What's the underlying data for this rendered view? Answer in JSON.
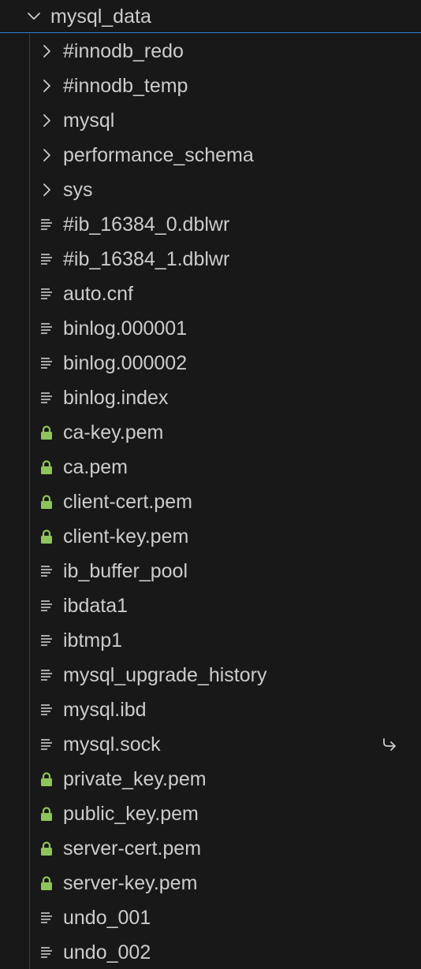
{
  "explorer": {
    "root": {
      "label": "mysql_data",
      "icon": "chevron-down-icon"
    },
    "items": [
      {
        "label": "#innodb_redo",
        "kind": "folder",
        "icon": "chevron-right-icon"
      },
      {
        "label": "#innodb_temp",
        "kind": "folder",
        "icon": "chevron-right-icon"
      },
      {
        "label": "mysql",
        "kind": "folder",
        "icon": "chevron-right-icon"
      },
      {
        "label": "performance_schema",
        "kind": "folder",
        "icon": "chevron-right-icon"
      },
      {
        "label": "sys",
        "kind": "folder",
        "icon": "chevron-right-icon"
      },
      {
        "label": "#ib_16384_0.dblwr",
        "kind": "file",
        "icon": "file-lines-icon"
      },
      {
        "label": "#ib_16384_1.dblwr",
        "kind": "file",
        "icon": "file-lines-icon"
      },
      {
        "label": "auto.cnf",
        "kind": "file",
        "icon": "file-lines-icon"
      },
      {
        "label": "binlog.000001",
        "kind": "file",
        "icon": "file-lines-icon"
      },
      {
        "label": "binlog.000002",
        "kind": "file",
        "icon": "file-lines-icon"
      },
      {
        "label": "binlog.index",
        "kind": "file",
        "icon": "file-lines-icon"
      },
      {
        "label": "ca-key.pem",
        "kind": "locked",
        "icon": "lock-icon"
      },
      {
        "label": "ca.pem",
        "kind": "locked",
        "icon": "lock-icon"
      },
      {
        "label": "client-cert.pem",
        "kind": "locked",
        "icon": "lock-icon"
      },
      {
        "label": "client-key.pem",
        "kind": "locked",
        "icon": "lock-icon"
      },
      {
        "label": "ib_buffer_pool",
        "kind": "file",
        "icon": "file-lines-icon"
      },
      {
        "label": "ibdata1",
        "kind": "file",
        "icon": "file-lines-icon"
      },
      {
        "label": "ibtmp1",
        "kind": "file",
        "icon": "file-lines-icon"
      },
      {
        "label": "mysql_upgrade_history",
        "kind": "file",
        "icon": "file-lines-icon"
      },
      {
        "label": "mysql.ibd",
        "kind": "file",
        "icon": "file-lines-icon"
      },
      {
        "label": "mysql.sock",
        "kind": "file",
        "icon": "file-lines-icon",
        "badge_icon": "symlink-arrow-icon"
      },
      {
        "label": "private_key.pem",
        "kind": "locked",
        "icon": "lock-icon"
      },
      {
        "label": "public_key.pem",
        "kind": "locked",
        "icon": "lock-icon"
      },
      {
        "label": "server-cert.pem",
        "kind": "locked",
        "icon": "lock-icon"
      },
      {
        "label": "server-key.pem",
        "kind": "locked",
        "icon": "lock-icon"
      },
      {
        "label": "undo_001",
        "kind": "file",
        "icon": "file-lines-icon"
      },
      {
        "label": "undo_002",
        "kind": "file",
        "icon": "file-lines-icon"
      }
    ]
  },
  "colors": {
    "background": "#181818",
    "text": "#cccccc",
    "lock": "#8fc45a",
    "focus_border": "#2f7fd8",
    "indent_guide": "#3c3c3c"
  }
}
